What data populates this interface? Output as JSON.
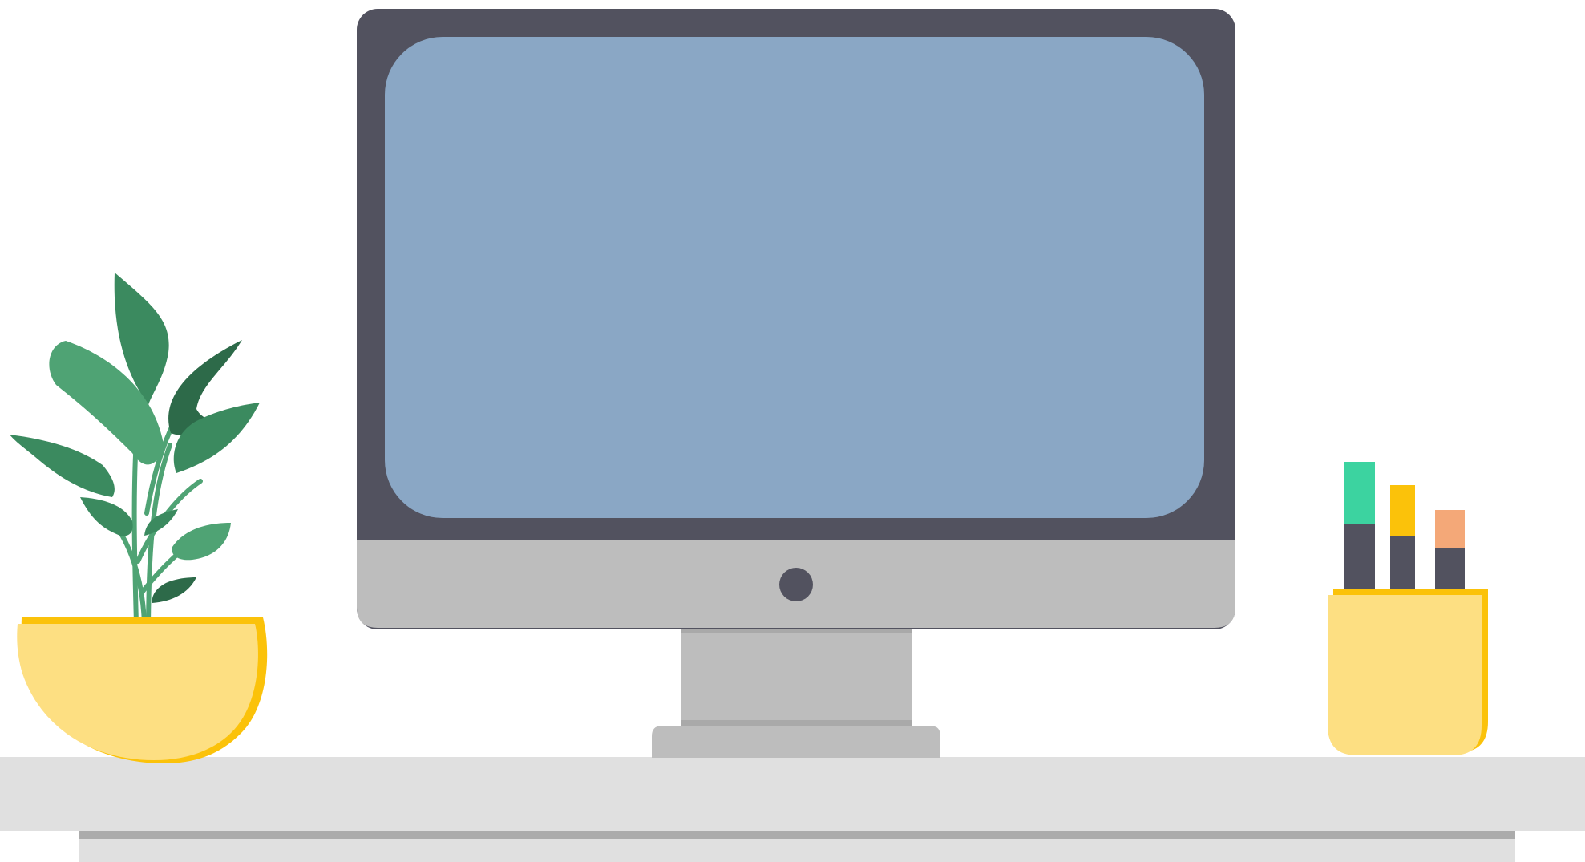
{
  "scene": {
    "objects": [
      "monitor",
      "potted-plant",
      "pen-holder",
      "desk"
    ]
  },
  "colors": {
    "background": "#ffffff",
    "monitor_bezel": "#52525f",
    "monitor_screen": "#8aa7c5",
    "monitor_chin": "#bdbdbd",
    "monitor_button": "#52525f",
    "stand": "#bdbdbd",
    "stand_shadow": "#a9a9a9",
    "desk_top": "#e0e0e0",
    "desk_shadow": "#ababab",
    "desk_leg": "#e0e0e0",
    "pot_fill": "#fddf82",
    "pot_rim": "#fbc20a",
    "leaf_mid": "#4fa374",
    "leaf_dark": "#3b8a5f",
    "leaf_darkest": "#2d6a49",
    "stem": "#4fa374",
    "pen_green": "#3cd3a0",
    "pen_yellow": "#fbc20a",
    "pen_orange": "#f4a878",
    "pen_body": "#52525f"
  }
}
